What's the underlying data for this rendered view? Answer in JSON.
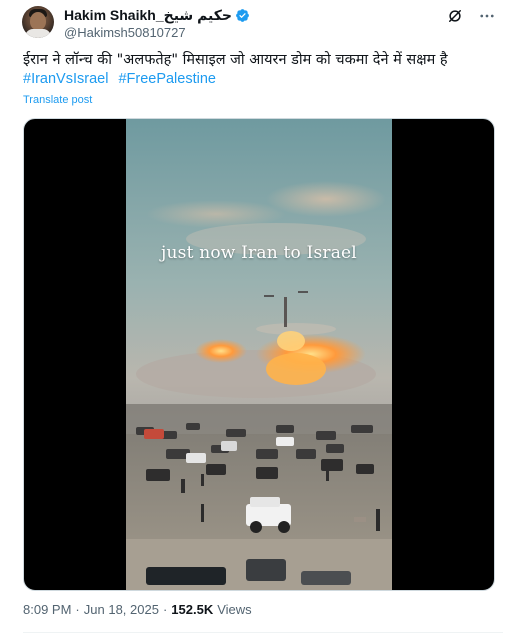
{
  "author": {
    "display_name": "Hakim Shaikh_حکیم شیخ",
    "handle": "@Hakimsh50810727",
    "verified_badge_color": "#1d9bf0"
  },
  "header_icons": [
    "grok-icon",
    "more-options-icon"
  ],
  "tweet": {
    "text": "ईरान ने लॉन्च की \"अलफतेह\" मिसाइल जो आयरन डोम को चकमा देने में सक्षम है",
    "hashtags": [
      "#IranVsIsrael",
      "#FreePalestine"
    ],
    "translate_label": "Translate post"
  },
  "media": {
    "overlay_caption": "just now Iran to Israel"
  },
  "meta": {
    "time": "8:09 PM",
    "separator": "·",
    "date": "Jun 18, 2025",
    "views_count": "152.5K",
    "views_label": "Views"
  },
  "colors": {
    "link": "#1d9bf0",
    "secondary_text": "#536471",
    "primary_text": "#0f1419"
  }
}
